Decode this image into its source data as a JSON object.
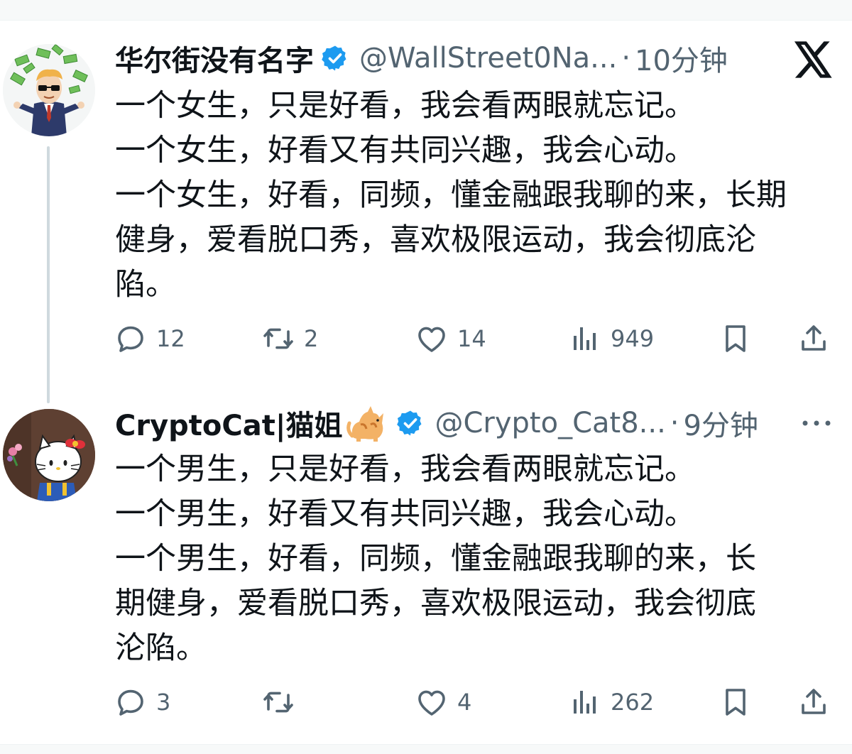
{
  "tweets": [
    {
      "name": "华尔街没有名字",
      "handle": "@WallStreet0Na...",
      "separator": "·",
      "time": "10分钟",
      "lines": [
        "一个女生，只是好看，我会看两眼就忘记。",
        "一个女生，好看又有共同兴趣，我会心动。",
        "一个女生，好看，同频，懂金融跟我聊的来，长期",
        "健身，爱看脱口秀，喜欢极限运动，我会彻底沦",
        "陷。"
      ],
      "replies": "12",
      "reposts": "2",
      "likes": "14",
      "views": "949"
    },
    {
      "name": "CryptoCat|猫姐",
      "handle": "@Crypto_Cat8...",
      "separator": "·",
      "time": "9分钟",
      "lines": [
        "一个男生，只是好看，我会看两眼就忘记。",
        "一个男生，好看又有共同兴趣，我会心动。",
        "一个男生，好看，同频，懂金融跟我聊的来，长",
        "期健身，爱看脱口秀，喜欢极限运动，我会彻底",
        "沦陷。"
      ],
      "replies": "3",
      "reposts": "",
      "likes": "4",
      "views": "262"
    }
  ],
  "icons": {
    "verified": "verified-badge-icon",
    "reply": "reply-icon",
    "repost": "repost-icon",
    "like": "heart-icon",
    "views": "views-icon",
    "bookmark": "bookmark-icon",
    "share": "share-icon",
    "x_logo": "x-logo-icon",
    "more": "more-icon",
    "cat_emoji": "cat-emoji-icon"
  },
  "colors": {
    "verified": "#1d9bf0",
    "text": "#0f1419",
    "secondary": "#536471",
    "thread_line": "#cfd9de"
  }
}
